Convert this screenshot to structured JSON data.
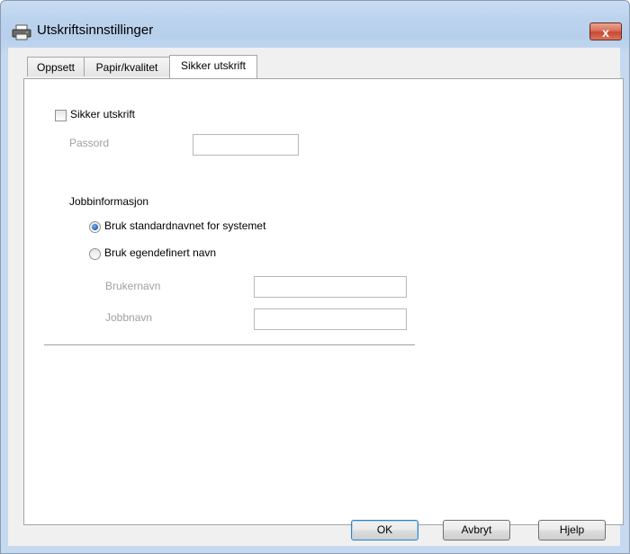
{
  "window": {
    "title": "Utskriftsinnstillinger",
    "close_glyph": "x"
  },
  "tabs": [
    {
      "label": "Oppsett",
      "active": false
    },
    {
      "label": "Papir/kvalitet",
      "active": false
    },
    {
      "label": "Sikker utskrift",
      "active": true
    }
  ],
  "secure": {
    "checkbox_label": "Sikker utskrift",
    "checked": false,
    "password_label": "Passord",
    "password_value": ""
  },
  "job": {
    "heading": "Jobbinformasjon",
    "options": [
      {
        "label": "Bruk standardnavnet for systemet",
        "selected": true
      },
      {
        "label": "Bruk egendefinert navn",
        "selected": false
      }
    ],
    "username_label": "Brukernavn",
    "username_value": "",
    "jobname_label": "Jobbnavn",
    "jobname_value": ""
  },
  "buttons": {
    "ok": "OK",
    "cancel": "Avbryt",
    "help": "Hjelp"
  },
  "icons": {
    "title": "printer-icon"
  }
}
